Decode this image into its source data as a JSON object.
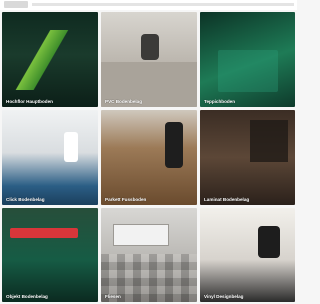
{
  "page": {
    "header_text": ""
  },
  "tiles": [
    {
      "label": "Hochflor Hauptboden",
      "desc": ""
    },
    {
      "label": "PVC Bodenbelag",
      "desc": ""
    },
    {
      "label": "Teppichboden",
      "desc": ""
    },
    {
      "label": "Click Bodenbelag",
      "desc": ""
    },
    {
      "label": "Parkett Fussboden",
      "desc": ""
    },
    {
      "label": "Laminat Bodenbelag",
      "desc": ""
    },
    {
      "label": "Objekt Bodenbelag",
      "desc": ""
    },
    {
      "label": "Fliesen",
      "desc": ""
    },
    {
      "label": "Vinyl Designbelag",
      "desc": ""
    }
  ],
  "colors": {
    "green_dark": "#0f3a2c",
    "green_mid": "#1f7a53",
    "wood": "#7a5a3a",
    "cream": "#f1eee8"
  }
}
